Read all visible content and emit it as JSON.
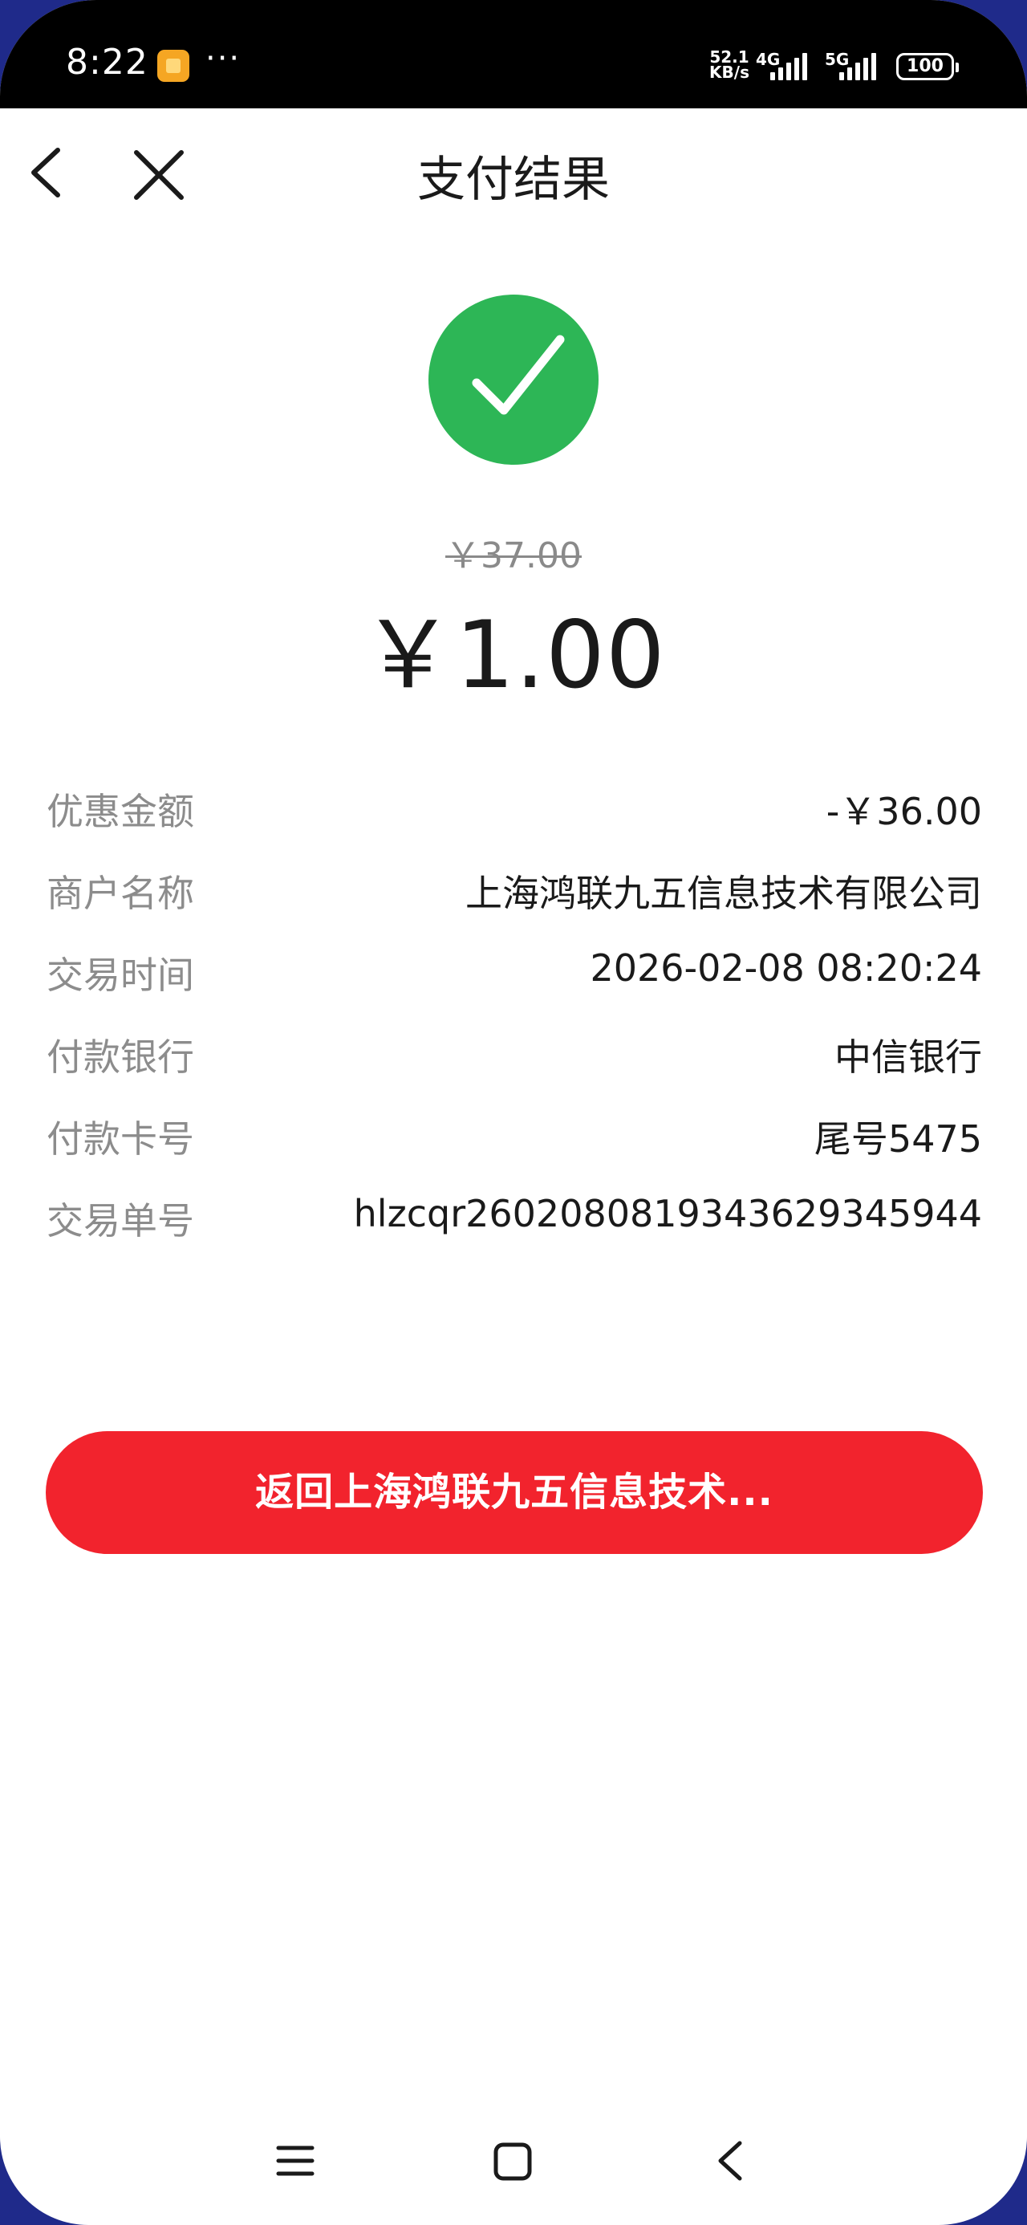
{
  "status_bar": {
    "time": "8:22",
    "more": "···",
    "speed_value": "52.1",
    "speed_unit": "KB/s",
    "net1": "4G",
    "net2": "5G",
    "battery": "100"
  },
  "header": {
    "title": "支付结果",
    "back_icon": "chevron-left-icon",
    "close_icon": "close-icon"
  },
  "result": {
    "icon": "check-circle-icon",
    "icon_color": "#2db656",
    "original_price": "￥37.00",
    "paid_amount": "￥1.00"
  },
  "details": [
    {
      "label": "优惠金额",
      "value": "-￥36.00"
    },
    {
      "label": "商户名称",
      "value": "上海鸿联九五信息技术有限公司"
    },
    {
      "label": "交易时间",
      "value": "2026-02-08 08:20:24"
    },
    {
      "label": "付款银行",
      "value": "中信银行"
    },
    {
      "label": "付款卡号",
      "value": "尾号5475"
    },
    {
      "label": "交易单号",
      "value": "hlzcqr2602080819343629345944"
    }
  ],
  "actions": {
    "return_label": "返回上海鸿联九五信息技术...",
    "return_color": "#f2232d"
  },
  "system_nav": {
    "menu_icon": "menu-icon",
    "home_icon": "home-square-icon",
    "back_icon": "back-chevron-icon"
  }
}
